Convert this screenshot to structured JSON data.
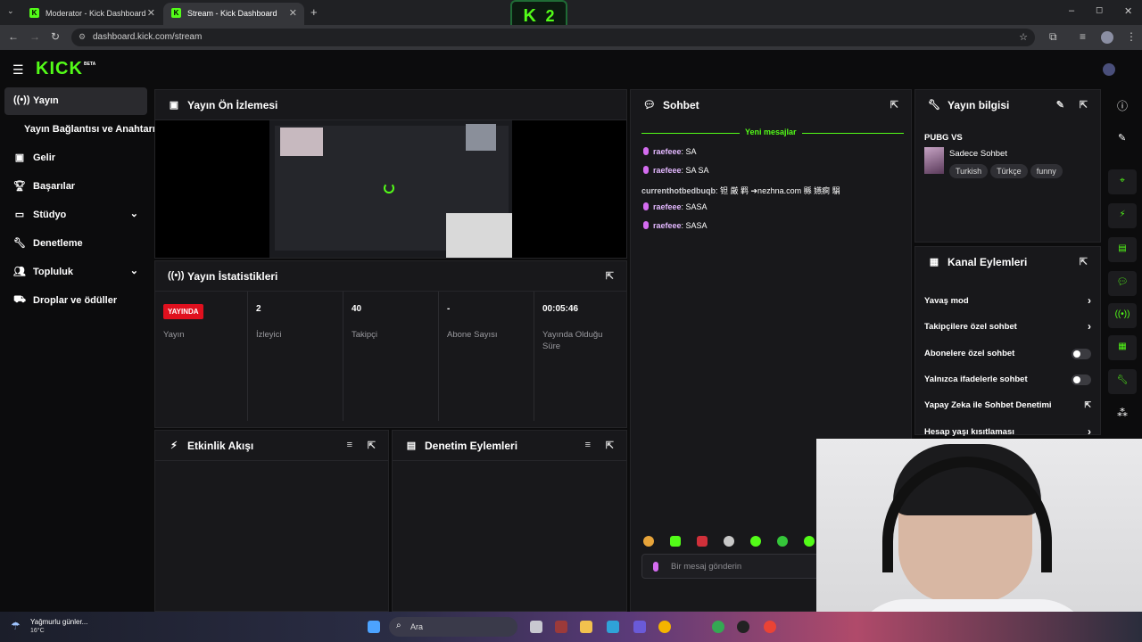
{
  "browser": {
    "tabs": [
      {
        "title": "Moderator - Kick Dashboard",
        "active": false
      },
      {
        "title": "Stream - Kick Dashboard",
        "active": true
      }
    ],
    "new_tab": "+",
    "url": "dashboard.kick.com/stream",
    "window_controls": [
      "–",
      "◻",
      "✕"
    ]
  },
  "overlay_badge": {
    "letter": "K",
    "number": "2"
  },
  "header": {
    "logo": "KICK",
    "logo_badge": "BETA"
  },
  "sidebar": {
    "items": [
      {
        "label": "Yayın",
        "icon": "broadcast-icon",
        "active": true
      },
      {
        "label": "Yayın Bağlantısı ve Anahtarı",
        "icon": "",
        "active": false
      },
      {
        "label": "Gelir",
        "icon": "revenue-icon",
        "active": false
      },
      {
        "label": "Başarılar",
        "icon": "trophy-icon",
        "active": false
      },
      {
        "label": "Stüdyo",
        "icon": "studio-icon",
        "active": false,
        "expandable": true
      },
      {
        "label": "Denetleme",
        "icon": "wrench-icon",
        "active": false
      },
      {
        "label": "Topluluk",
        "icon": "community-icon",
        "active": false,
        "expandable": true
      },
      {
        "label": "Droplar ve ödüller",
        "icon": "drops-icon",
        "active": false
      }
    ]
  },
  "preview": {
    "title": "Yayın Ön İzlemesi"
  },
  "stats": {
    "title": "Yayın İstatistikleri",
    "live_badge": "YAYINDA",
    "items": [
      {
        "value": "",
        "label": "Yayın"
      },
      {
        "value": "2",
        "label": "İzleyici"
      },
      {
        "value": "40",
        "label": "Takipçi"
      },
      {
        "value": "-",
        "label": "Abone Sayısı"
      },
      {
        "value": "00:05:46",
        "label": "Yayında Olduğu Süre"
      }
    ]
  },
  "activity": {
    "title": "Etkinlik Akışı"
  },
  "moderation": {
    "title": "Denetim Eylemleri"
  },
  "chat": {
    "title": "Sohbet",
    "new_messages": "Yeni mesajlar",
    "messages": [
      {
        "user": "raefeee",
        "text": "SA"
      },
      {
        "user": "raefeee",
        "text": "SA SA"
      },
      {
        "user": "currenthotbedbuqb",
        "text": "钽 厳 羁 ➔nezhna.com 縣 嬿痾 駽"
      },
      {
        "user": "raefeee",
        "text": "SASA"
      },
      {
        "user": "raefeee",
        "text": "SASA"
      }
    ],
    "input_placeholder": "Bir mesaj gönderin"
  },
  "stream_info": {
    "title": "Yayın bilgisi",
    "stream_title": "PUBG VS",
    "category": "Sadece Sohbet",
    "tags": [
      "Turkish",
      "Türkçe",
      "funny"
    ]
  },
  "channel_actions": {
    "title": "Kanal Eylemleri",
    "items": [
      {
        "label": "Yavaş mod",
        "control": "chevron"
      },
      {
        "label": "Takipçilere özel sohbet",
        "control": "chevron"
      },
      {
        "label": "Abonelere özel sohbet",
        "control": "toggle"
      },
      {
        "label": "Yalnızca ifadelerle sohbet",
        "control": "toggle"
      },
      {
        "label": "Yapay Zeka ile Sohbet Denetimi",
        "control": "external"
      },
      {
        "label": "Hesap yaşı kısıtlaması",
        "control": "chevron"
      }
    ]
  },
  "taskbar": {
    "weather_line1": "Yağmurlu günler...",
    "weather_line2": "16°C",
    "search_label": "Ara"
  },
  "colors": {
    "accent": "#53fc18",
    "live": "#e0101e",
    "panel": "#18181b",
    "background": "#0c0c0d"
  }
}
